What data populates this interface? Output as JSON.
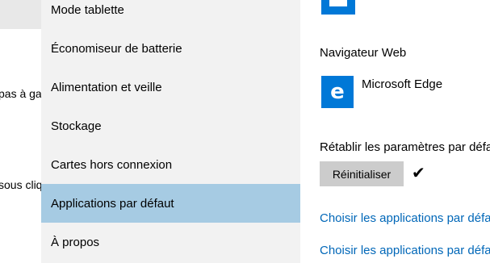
{
  "background_fragments": {
    "frag1": "pas à gau",
    "frag2": "sous cliq"
  },
  "nav": {
    "items": [
      {
        "label": "Mode tablette"
      },
      {
        "label": "Économiseur de batterie"
      },
      {
        "label": "Alimentation et veille"
      },
      {
        "label": "Stockage"
      },
      {
        "label": "Cartes hors connexion"
      },
      {
        "label": "Applications par défaut",
        "selected": true
      },
      {
        "label": "À propos"
      }
    ]
  },
  "content": {
    "web_browser_heading": "Navigateur Web",
    "default_browser": "Microsoft Edge",
    "edge_icon_glyph": "e",
    "reset_heading": "Rétablir les paramètres par défaut",
    "reset_button": "Réinitialiser",
    "reset_done_mark": "✔",
    "link1": "Choisir les applications par défaut",
    "link2": "Choisir les applications par défaut"
  },
  "colors": {
    "selected_bg": "#a6cbe3",
    "accent": "#0078d7",
    "link": "#0067b8"
  }
}
